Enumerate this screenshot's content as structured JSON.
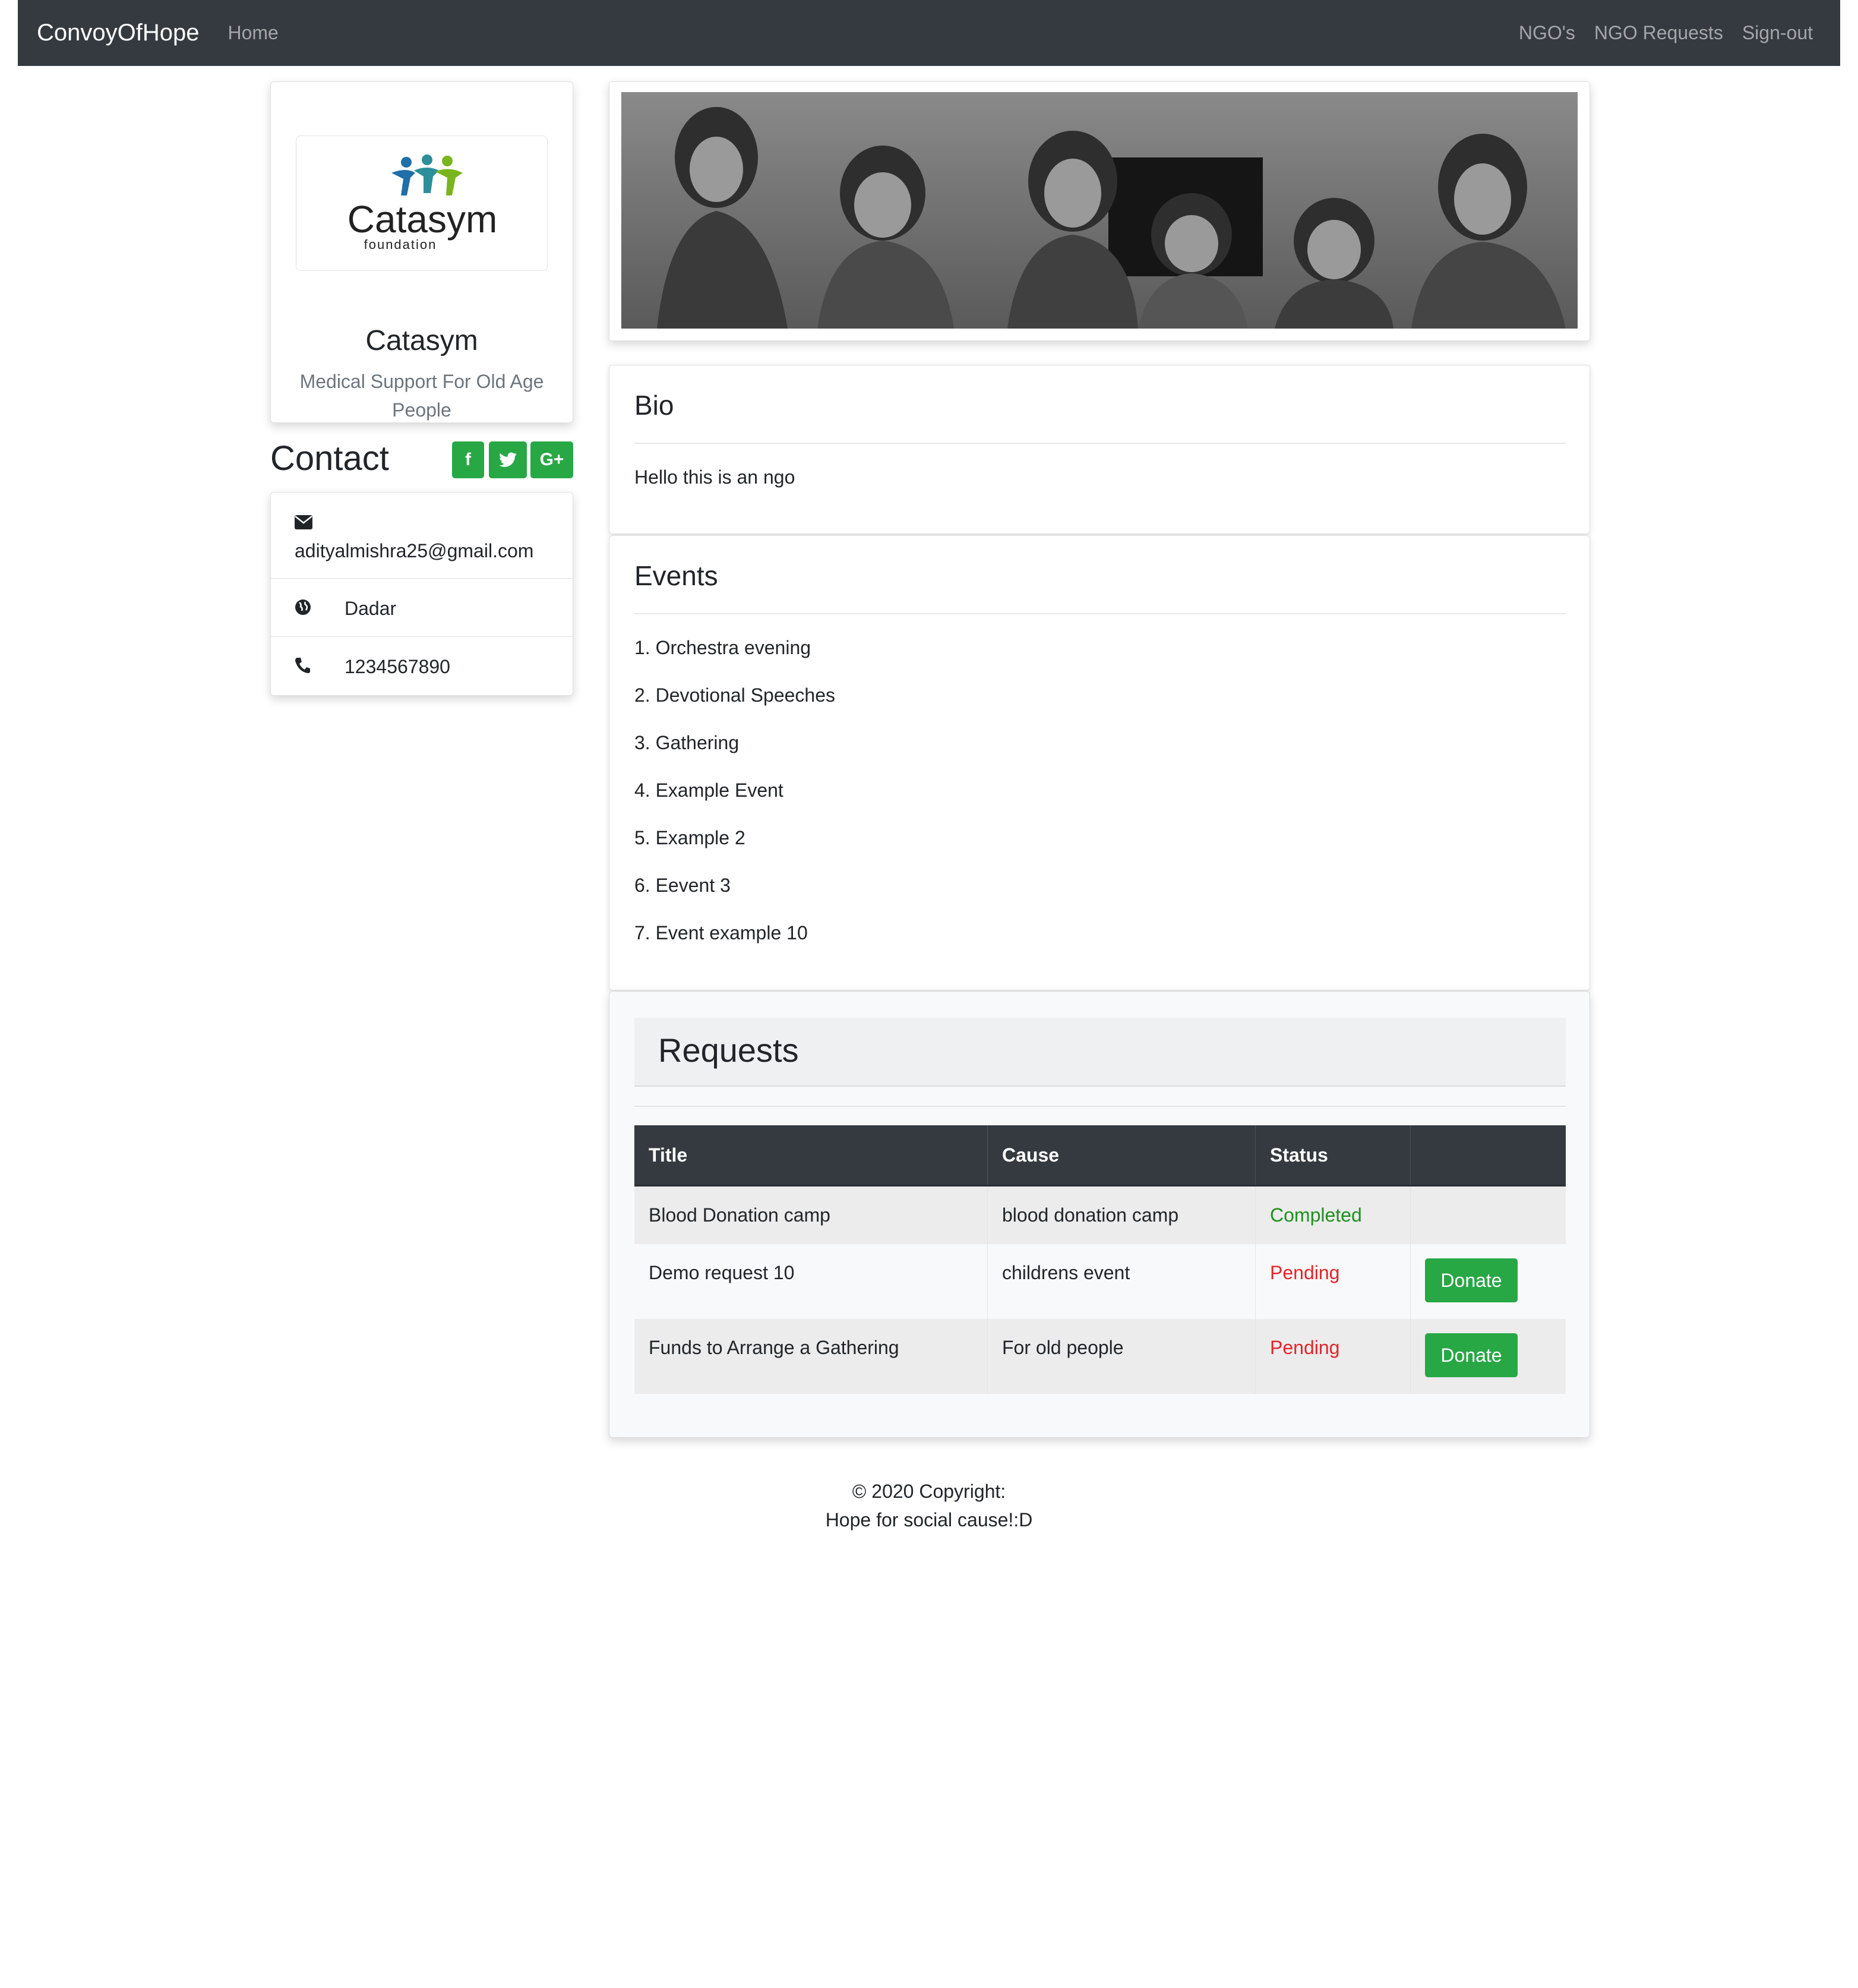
{
  "nav": {
    "brand": "ConvoyOfHope",
    "home": "Home",
    "ngos": "NGO's",
    "ngo_requests": "NGO Requests",
    "signout": "Sign-out"
  },
  "profile": {
    "logo_text": "Catasym",
    "logo_sub": "foundation",
    "name": "Catasym",
    "tagline": "Medical Support For Old Age People"
  },
  "contact": {
    "title": "Contact",
    "social": [
      {
        "icon": "facebook-icon",
        "glyph": "f"
      },
      {
        "icon": "twitter-icon",
        "glyph": "t"
      },
      {
        "icon": "google-plus-icon",
        "glyph": "G+"
      }
    ],
    "email": "adityalmishra25@gmail.com",
    "location": "Dadar",
    "phone": "1234567890"
  },
  "bio": {
    "title": "Bio",
    "text": "Hello this is an ngo"
  },
  "events": {
    "title": "Events",
    "items": [
      "1. Orchestra evening",
      "2. Devotional Speeches",
      "3. Gathering",
      "4. Example Event",
      "5. Example 2",
      "6. Eevent 3",
      "7. Event example 10"
    ]
  },
  "requests": {
    "title": "Requests",
    "columns": [
      "Title",
      "Cause",
      "Status",
      ""
    ],
    "rows": [
      {
        "title": "Blood Donation camp",
        "cause": "blood donation camp",
        "status": "Completed",
        "action": ""
      },
      {
        "title": "Demo request 10",
        "cause": "childrens event",
        "status": "Pending",
        "action": "Donate"
      },
      {
        "title": "Funds to Arrange a Gathering",
        "cause": "For old people",
        "status": "Pending",
        "action": "Donate"
      }
    ]
  },
  "footer": {
    "line1": "© 2020 Copyright:",
    "line2": "Hope for social cause!:D"
  },
  "colors": {
    "navbar": "#343a40",
    "accent_green": "#28a745",
    "completed": "#1e8f1e",
    "pending": "#e3242b"
  }
}
